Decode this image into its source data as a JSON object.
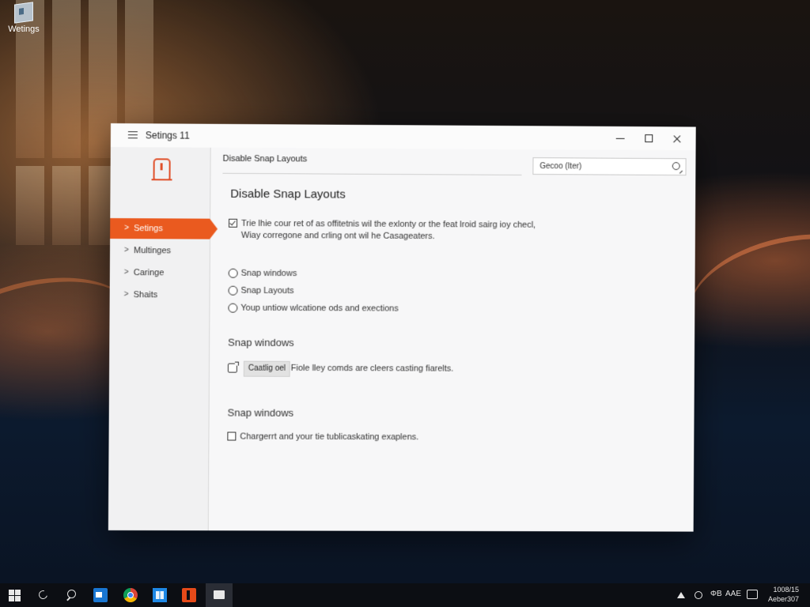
{
  "desktop": {
    "icon_label": "Wetings"
  },
  "window": {
    "title": "Setings 11"
  },
  "sidebar": {
    "items": [
      {
        "label": "Setings",
        "active": true
      },
      {
        "label": "Multinges"
      },
      {
        "label": "Caringe"
      },
      {
        "label": "Shaits"
      }
    ]
  },
  "header": {
    "breadcrumb": "Disable Snap Layouts",
    "search_value": "Gecoo (Iter)"
  },
  "main": {
    "page_title": "Disable Snap Layouts",
    "checkbox_main": {
      "checked": true,
      "line1": "Trie lhie cour ret of as offitetnis wil the exlonty or the feat lroid sairg ioy checl,",
      "line2": "Wiay corregone and crling ont wil he Casageaters."
    },
    "radio_options": [
      "Snap windows",
      "Snap Layouts",
      "Youp untiow wlcatione ods and exections"
    ],
    "section1": {
      "title": "Snap windows",
      "button_label": "Caatlig oel",
      "text": "Fiole lley comds are cleers casting fiarelts."
    },
    "section2": {
      "title": "Snap windows",
      "checkbox_text": "Chargerrt and your tie tublicaskating exaplens."
    }
  },
  "taskbar": {
    "tray_text": "ΦB",
    "tray_lang": "AAE",
    "clock_time": "1008/15",
    "clock_date": "Aeber307"
  }
}
